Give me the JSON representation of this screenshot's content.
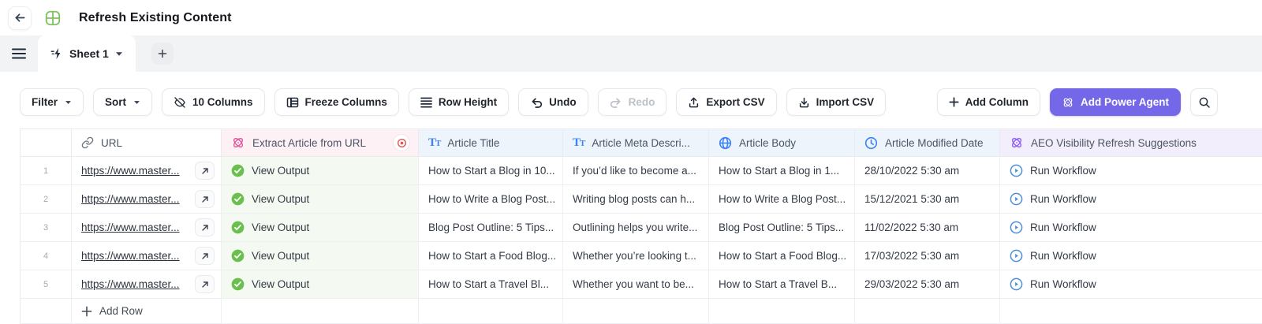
{
  "header": {
    "title": "Refresh Existing Content"
  },
  "tabbar": {
    "active_tab": "Sheet 1",
    "add_tab": "+"
  },
  "toolbar": {
    "filter": "Filter",
    "sort": "Sort",
    "columns": "10 Columns",
    "freeze_columns": "Freeze Columns",
    "row_height": "Row Height",
    "undo": "Undo",
    "redo": "Redo",
    "export_csv": "Export CSV",
    "import_csv": "Import CSV",
    "add_column": "Add Column",
    "add_power_agent": "Add Power Agent"
  },
  "table": {
    "headers": {
      "url": "URL",
      "extract": "Extract Article from URL",
      "title": "Article Title",
      "meta": "Article Meta Descri...",
      "body": "Article Body",
      "modified": "Article Modified Date",
      "aeo": "AEO Visibility Refresh Suggestions"
    },
    "rows": [
      {
        "num": "1",
        "url": "https://www.master...",
        "extract": "View Output",
        "title": "How to Start a Blog in 10...",
        "meta": "If you’d like to become a...",
        "body": "How to Start a Blog in 1...",
        "modified": "28/10/2022 5:30 am",
        "aeo": "Run Workflow"
      },
      {
        "num": "2",
        "url": "https://www.master...",
        "extract": "View Output",
        "title": "How to Write a Blog Post...",
        "meta": "Writing blog posts can h...",
        "body": "How to Write a Blog Post...",
        "modified": "15/12/2021 5:30 am",
        "aeo": "Run Workflow"
      },
      {
        "num": "3",
        "url": "https://www.master...",
        "extract": "View Output",
        "title": "Blog Post Outline: 5 Tips...",
        "meta": "Outlining helps you write...",
        "body": "Blog Post Outline: 5 Tips...",
        "modified": "11/02/2022 5:30 am",
        "aeo": "Run Workflow"
      },
      {
        "num": "4",
        "url": "https://www.master...",
        "extract": "View Output",
        "title": "How to Start a Food Blog...",
        "meta": "Whether you’re looking t...",
        "body": "How to Start a Food Blog...",
        "modified": "17/03/2022 5:30 am",
        "aeo": "Run Workflow"
      },
      {
        "num": "5",
        "url": "https://www.master...",
        "extract": "View Output",
        "title": "How to Start a Travel Bl...",
        "meta": "Whether you want to be...",
        "body": "How to Start a Travel B...",
        "modified": "29/03/2022 5:30 am",
        "aeo": "Run Workflow"
      }
    ],
    "add_row": "Add Row"
  },
  "colors": {
    "accent_purple": "#7568e8",
    "header_pink_bg": "#fdf1f5",
    "header_blue_bg": "#edf4fc",
    "header_purple_bg": "#f3eefb",
    "cell_green_bg": "#f4faf1",
    "icon_pink": "#e1549b",
    "icon_blue": "#3b82f6",
    "icon_purple": "#8b5cf6",
    "icon_green": "#6abf4e",
    "icon_red": "#e25555",
    "logo_green": "#82c15e"
  }
}
